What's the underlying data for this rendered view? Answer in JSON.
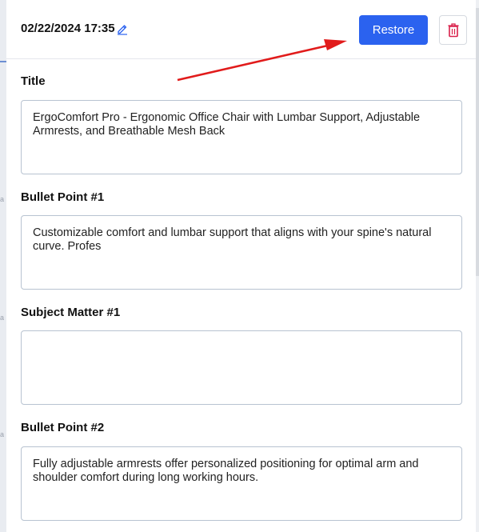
{
  "header": {
    "timestamp": "02/22/2024 17:35",
    "restore_label": "Restore"
  },
  "icons": {
    "edit": "pencil-icon",
    "delete": "trash-icon",
    "annotation": "red-arrow"
  },
  "colors": {
    "primary": "#2b62ef",
    "delete": "#d9204a",
    "arrow": "#e11b1b"
  },
  "fields": [
    {
      "label": "Title",
      "value": "ErgoComfort Pro - Ergonomic Office Chair with Lumbar Support, Adjustable Armrests, and Breathable Mesh Back"
    },
    {
      "label": "Bullet Point #1",
      "value": "Customizable comfort and lumbar support that aligns with your spine's natural curve. Profes"
    },
    {
      "label": "Subject Matter #1",
      "value": ""
    },
    {
      "label": "Bullet Point #2",
      "value": "Fully adjustable armrests offer personalized positioning for optimal arm and shoulder comfort during long working hours."
    }
  ]
}
